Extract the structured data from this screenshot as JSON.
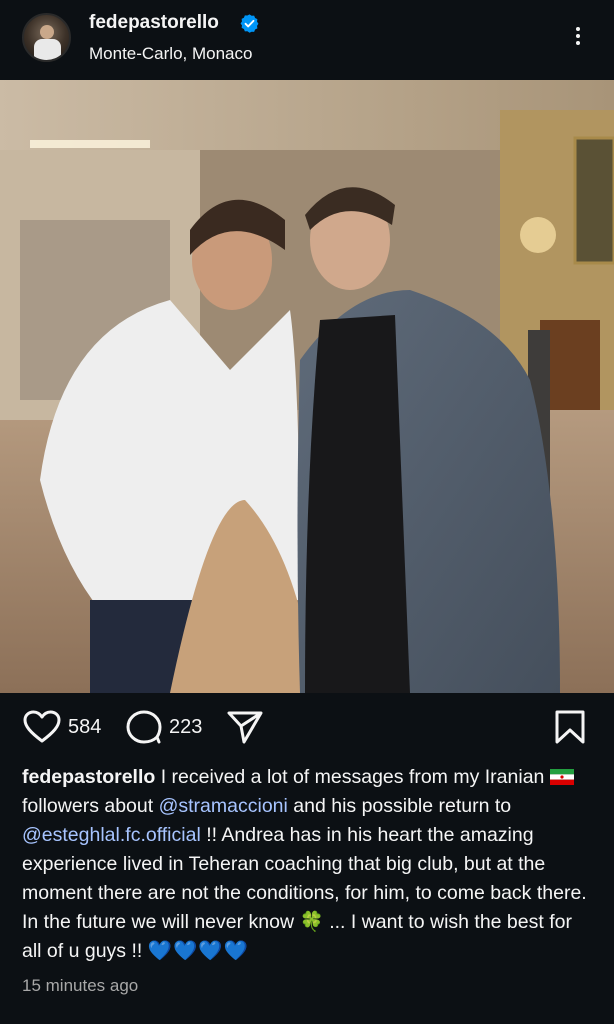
{
  "post": {
    "username": "fedepastorello",
    "location": "Monte-Carlo, Monaco",
    "verified": true
  },
  "icons": {
    "avatar": "profile-avatar",
    "verified": "verified-badge-icon",
    "more": "more-options-icon",
    "like": "heart-icon",
    "comment": "comment-icon",
    "share": "send-icon",
    "save": "bookmark-icon",
    "flag": "iran-flag-emoji",
    "clover": "four-leaf-clover-emoji",
    "hearts": "blue-heart-emoji"
  },
  "actions": {
    "likes": "584",
    "comments": "223"
  },
  "caption": {
    "username": "fedepastorello",
    "part1": "I received a lot of messages from my Iranian",
    "part2": "followers about",
    "mention1": "@stramaccioni",
    "part3": "and his possible return to",
    "mention2": "@esteghlal.fc.official",
    "part4": "!! Andrea has in his heart the amazing experience lived in Teheran coaching that big club, but at the moment there are not the conditions, for him, to come back there. In the future we will never know",
    "clover": "🍀",
    "part5": "... I want to wish the best for all of u guys !!",
    "hearts": "💙💙💙💙"
  },
  "timestamp": "15 minutes ago",
  "colors": {
    "background": "#0c1014",
    "text": "#f5f5f5",
    "mention": "#a7c4ff",
    "verified": "#0095f6",
    "muted": "#a8a8a8"
  }
}
